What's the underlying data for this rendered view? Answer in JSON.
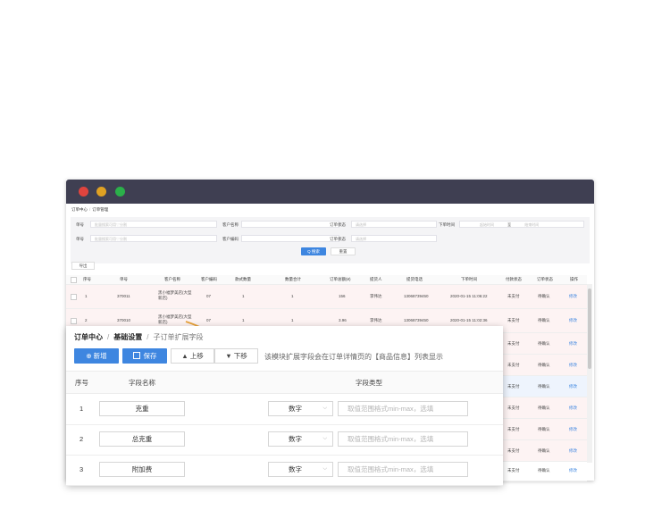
{
  "app": {
    "breadcrumb": [
      "订单中心",
      "订单管理"
    ]
  },
  "filters": {
    "order_no_label": "单号",
    "order_no_placeholder": "批量搜索可用\",\"分割",
    "customer_name_label": "客户名称",
    "order_status_label": "订单状态",
    "order_status_placeholder": "请选择",
    "order_time_label": "下单时间",
    "start_date_placeholder": "起始时间",
    "date_sep": "至",
    "end_date_placeholder": "结束时间",
    "ref_no_label": "单号",
    "ref_no_placeholder": "批量搜索可用\",\"分割",
    "customer_code_label": "客户编码",
    "pay_status_label": "订单状态",
    "pay_status_placeholder": "请选择",
    "search_label": "Q 搜索",
    "reset_label": "重置"
  },
  "export_label": "导出",
  "table": {
    "headers": [
      "序号",
      "单号",
      "客户名称",
      "客户编码",
      "款式数量",
      "数量合计",
      "订单总额(¥)",
      "提货人",
      "提货电话",
      "下单时间",
      "付款状态",
      "订单状态",
      "操作"
    ],
    "rows": [
      {
        "no": "1",
        "order": "370011",
        "customer": "黑小福梦美店(大型新店)",
        "code": "07",
        "styles": "1",
        "qty": "1",
        "total": "156",
        "picker": "李伟达",
        "phone": "13068739450",
        "time": "2020-01-15 11:06:22",
        "pay": "未支付",
        "status": "待确认",
        "op": "修改"
      },
      {
        "no": "2",
        "order": "370010",
        "customer": "黑小福梦美店(大型新店)",
        "code": "07",
        "styles": "1",
        "qty": "1",
        "total": "3.96",
        "picker": "李伟达",
        "phone": "13068739450",
        "time": "2020-01-15 11:02:36",
        "pay": "未支付",
        "status": "待确认",
        "op": "修改"
      }
    ],
    "hidden_rows": [
      {
        "pay": "未支付",
        "status": "待确认",
        "op": "修改"
      },
      {
        "pay": "未支付",
        "status": "待确认",
        "op": "修改"
      },
      {
        "pay": "未支付",
        "status": "待确认",
        "op": "修改"
      },
      {
        "pay": "未支付",
        "status": "待确认",
        "op": "修改"
      },
      {
        "pay": "未支付",
        "status": "待确认",
        "op": "修改"
      },
      {
        "pay": "未支付",
        "status": "待确认",
        "op": "修改"
      },
      {
        "pay": "未支付",
        "status": "待确认",
        "op": "修改"
      }
    ]
  },
  "panel": {
    "breadcrumb": {
      "root": "订单中心",
      "mid": "基础设置",
      "current": "子订单扩展字段"
    },
    "buttons": {
      "add": "⊕ 新增",
      "save": "保存",
      "up": "▲ 上移",
      "down": "▼ 下移"
    },
    "hint": "该模块扩展字段会在订单详情页的【商品信息】列表显示",
    "headers": {
      "no": "序号",
      "name": "字段名称",
      "type": "字段类型"
    },
    "rows": [
      {
        "no": "1",
        "name": "克重",
        "type": "数字",
        "placeholder": "取值范围格式min-max，选填"
      },
      {
        "no": "2",
        "name": "总克重",
        "type": "数字",
        "placeholder": "取值范围格式min-max，选填"
      },
      {
        "no": "3",
        "name": "附加费",
        "type": "数字",
        "placeholder": "取值范围格式min-max，选填"
      }
    ]
  },
  "colors": {
    "titlebar": "#3f3f52",
    "primary": "#3e86e0",
    "close": "#e0443e",
    "minimize": "#dfa123",
    "maximize": "#2bb04a"
  }
}
